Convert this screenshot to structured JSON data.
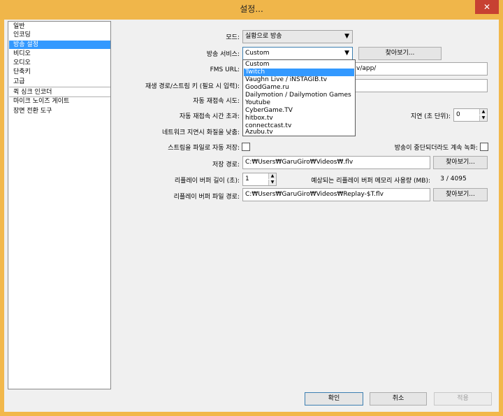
{
  "window": {
    "title": "설정...",
    "close": "✕"
  },
  "sidebar": {
    "items": [
      "일반",
      "인코딩",
      "방송 설정",
      "비디오",
      "오디오",
      "단축키",
      "고급",
      "퀵 싱크 인코더",
      "마이크 노이즈 게이트",
      "장면 전환 도구"
    ],
    "selected_index": 2
  },
  "form": {
    "mode_label": "모드:",
    "mode_value": "실황으로 방송",
    "service_label": "방송 서비스:",
    "service_value": "Custom",
    "browse_label": "찾아보기...",
    "fms_label": "FMS URL:",
    "fms_value": "v/app/",
    "stream_key_label": "재생 경로/스트림 키 (필요 시 입력):",
    "auto_reconnect_label": "자동 재접속 시도:",
    "reconnect_time_label": "자동 재접속 시간 초과:",
    "delay_label": "지연 (초 단위):",
    "delay_value": "0",
    "low_quality_label": "네트워크 지연시 화질을 낮춤:",
    "auto_save_label": "스트림을 파일로 자동 저장:",
    "keep_recording_label": "방송이 중단되더라도 계속 녹화:",
    "save_path_label": "저장 경로:",
    "save_path_value": "C:₩Users₩GaruGiro₩Videos₩.flv",
    "replay_length_label": "리플레이 버퍼 길이 (초):",
    "replay_length_value": "1",
    "memory_label": "예상되는 리플레이 버퍼 메모리 사용량 (MB):",
    "memory_value": "3 / 4095",
    "replay_path_label": "리플레이 버퍼 파일 경로:",
    "replay_path_value": "C:₩Users₩GaruGiro₩Videos₩Replay-$T.flv"
  },
  "dropdown": {
    "options": [
      "Custom",
      "Twitch",
      "Vaughn Live / iNSTAGIB.tv",
      "GoodGame.ru",
      "Dailymotion / Dailymotion Games",
      "Youtube",
      "CyberGame.TV",
      "hitbox.tv",
      "connectcast.tv",
      "Azubu.tv"
    ],
    "highlighted_index": 1
  },
  "buttons": {
    "ok": "확인",
    "cancel": "취소",
    "apply": "적용"
  }
}
